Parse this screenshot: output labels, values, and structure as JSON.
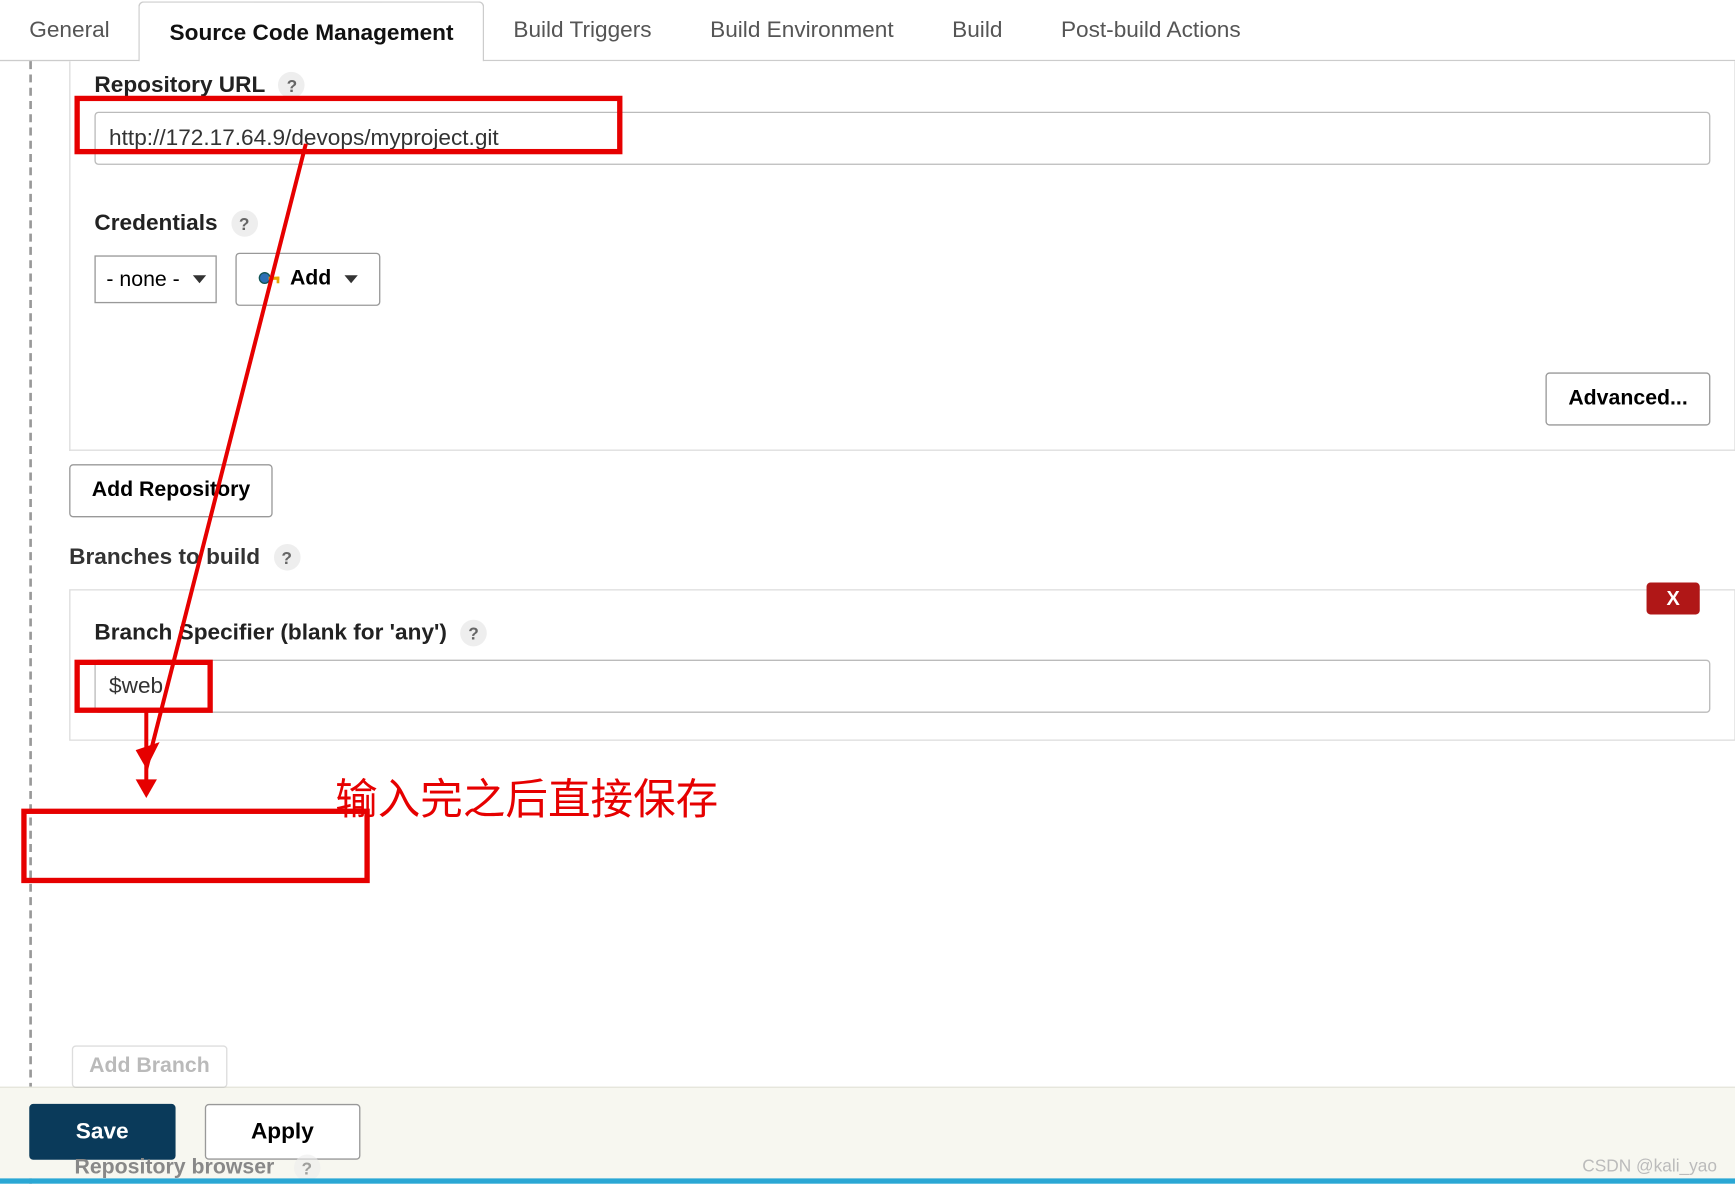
{
  "tabs": {
    "general": "General",
    "scm": "Source Code Management",
    "triggers": "Build Triggers",
    "env": "Build Environment",
    "build": "Build",
    "post": "Post-build Actions"
  },
  "repo": {
    "url_label": "Repository URL",
    "url_value": "http://172.17.64.9/devops/myproject.git",
    "credentials_label": "Credentials",
    "credentials_value": "- none -",
    "add_label": "Add",
    "advanced_label": "Advanced...",
    "add_repo_label": "Add Repository"
  },
  "branches": {
    "heading": "Branches to build",
    "specifier_label": "Branch Specifier (blank for 'any')",
    "specifier_value": "$web",
    "delete_label": "X",
    "add_branch_label": "Add Branch"
  },
  "repo_browser": {
    "label": "Repository browser"
  },
  "footer": {
    "save": "Save",
    "apply": "Apply"
  },
  "annotation": {
    "note": "输入完之后直接保存"
  },
  "help_glyph": "?",
  "watermark": "CSDN @kali_yao",
  "colors": {
    "annotation_red": "#e60000",
    "delete_red": "#b01717",
    "primary_blue": "#0a3a5a"
  }
}
